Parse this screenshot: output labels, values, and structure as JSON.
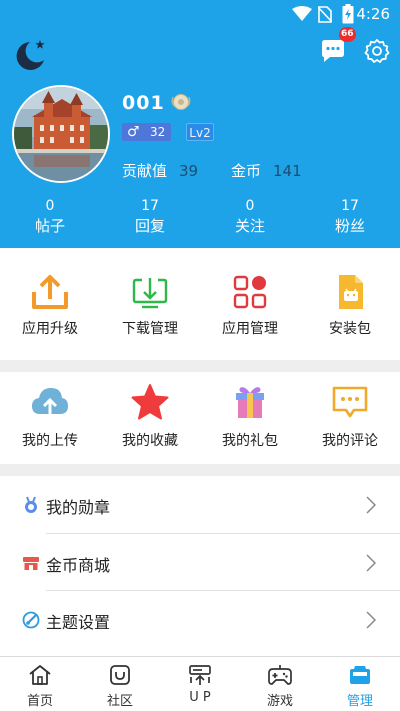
{
  "status_bar": {
    "time": "4:26"
  },
  "header": {
    "chat_badge": "66",
    "username": "001",
    "gender_symbol": "♂",
    "gender_count": "32",
    "level": "Lv2",
    "contribution_label": "贡献值",
    "contribution_value": "39",
    "coins_label": "金币",
    "coins_value": "141",
    "stats": [
      {
        "value": "0",
        "label": "帖子"
      },
      {
        "value": "17",
        "label": "回复"
      },
      {
        "value": "0",
        "label": "关注"
      },
      {
        "value": "17",
        "label": "粉丝"
      }
    ]
  },
  "grid_apps": [
    {
      "label": "应用升级",
      "icon": "upload-tray-icon"
    },
    {
      "label": "下载管理",
      "icon": "download-tray-icon"
    },
    {
      "label": "应用管理",
      "icon": "apps-grid-icon"
    },
    {
      "label": "安装包",
      "icon": "apk-file-icon"
    }
  ],
  "grid_mine": [
    {
      "label": "我的上传",
      "icon": "cloud-upload-icon"
    },
    {
      "label": "我的收藏",
      "icon": "star-icon"
    },
    {
      "label": "我的礼包",
      "icon": "gift-icon"
    },
    {
      "label": "我的评论",
      "icon": "comment-icon"
    }
  ],
  "list": [
    {
      "label": "我的勋章",
      "icon": "medal-icon"
    },
    {
      "label": "金币商城",
      "icon": "shop-icon"
    },
    {
      "label": "主题设置",
      "icon": "palette-icon"
    }
  ],
  "bottom_nav": [
    {
      "label": "首页",
      "icon": "home-icon"
    },
    {
      "label": "社区",
      "icon": "community-icon"
    },
    {
      "label": "U P",
      "icon": "up-icon"
    },
    {
      "label": "游戏",
      "icon": "gamepad-icon"
    },
    {
      "label": "管理",
      "icon": "manage-icon",
      "active": true
    }
  ],
  "colors": {
    "primary": "#1fa3e8",
    "badge_red": "#ef2b2b",
    "separator": "#eeeeee"
  }
}
